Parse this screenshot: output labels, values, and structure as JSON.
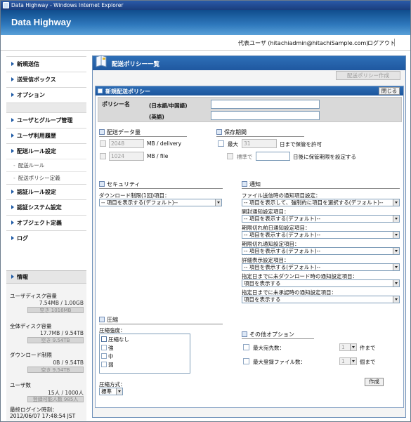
{
  "window": {
    "title": "Data Highway - Windows Internet Explorer"
  },
  "header": {
    "logo": "Data Highway",
    "user": "代表ユーザ (hitachiadmin@hitachiSample.com)",
    "logout": "ログアウト"
  },
  "sidebar": {
    "group1": [
      "新規送信",
      "送受信ボックス",
      "オプション"
    ],
    "group2": [
      "ユーザとグループ管理",
      "ユーザ利用履歴",
      "配送ルール設定"
    ],
    "subs": [
      "配送ルール",
      "配送ポリシー定義"
    ],
    "group3": [
      "認証ルール設定",
      "認証システム設定",
      "オブジェクト定義",
      "ログ"
    ]
  },
  "info": {
    "title": "情報",
    "user_disk_label": "ユーザディスク容量",
    "user_disk_value": "7.54MB / 1.00GB",
    "user_disk_free": "空き 1016MB",
    "total_disk_label": "全体ディスク容量",
    "total_disk_value": "17.7MB / 9.54TB",
    "total_disk_free": "空き 9.54TB",
    "download_label": "ダウンロード制限",
    "download_value": "0B / 9.54TB",
    "download_free": "空き 9.54TB",
    "users_label": "ユーザ数",
    "users_value": "15人 / 1000人",
    "users_free": "登録可能人数 985人",
    "last_login_label": "最終ログイン時刻：",
    "last_login_value": "2012/06/07 17:48:54 JST"
  },
  "main": {
    "title": "配送ポリシー一覧",
    "create_top": "配送ポリシー作成",
    "panel_title": "新規配送ポリシー",
    "close": "閉じる",
    "policy_name": "ポリシー名",
    "lang_ja": "(日本語/中国語)",
    "lang_en": "(英語)",
    "data_amount": {
      "title": "配送データ量",
      "delivery_value": "2048",
      "delivery_unit": "MB / delivery",
      "file_value": "1024",
      "file_unit": "MB / file"
    },
    "retention": {
      "title": "保存期間",
      "max_label": "最大",
      "max_value": "31",
      "max_suffix": "日まで保管を許可",
      "std_label": "標準で",
      "std_suffix": "日後に保管期限を設定する"
    },
    "security": {
      "title": "セキュリティ",
      "label": "ダウンロード制限(1回)項目：",
      "select": "-- 項目を表示する(デフォルト)--"
    },
    "compression": {
      "title": "圧縮",
      "strength_label": "圧縮強度：",
      "options": [
        "圧縮なし",
        "強",
        "中",
        "弱"
      ],
      "method_label": "圧縮方式：",
      "method_value": "標準"
    },
    "notify": {
      "title": "通知",
      "items": [
        {
          "label": "ファイル送信時の通知項目設定：",
          "value": "-- 項目を表示して、強制的に項目を選択する(デフォルト)--"
        },
        {
          "label": "開封通知設定項目：",
          "value": "-- 項目を表示する(デフォルト)--"
        },
        {
          "label": "期限切れ前日通知設定項目：",
          "value": "-- 項目を表示する(デフォルト)--"
        },
        {
          "label": "期限切れ通知設定項目：",
          "value": "-- 項目を表示する(デフォルト)--"
        },
        {
          "label": "詳細表示設定項目：",
          "value": "-- 項目を表示する(デフォルト)--"
        },
        {
          "label": "指定日までに未ダウンロード時の通知設定項目：",
          "value": "項目を表示する"
        },
        {
          "label": "指定日までに未承認時の通知設定項目：",
          "value": "項目を表示する"
        }
      ]
    },
    "other": {
      "title": "その他オプション",
      "max_recipients": "最大宛先数：",
      "max_recipients_value": "1",
      "max_recipients_unit": "件まで",
      "max_files": "最大登録ファイル数：",
      "max_files_value": "1",
      "max_files_unit": "個まで"
    },
    "create": "作成"
  }
}
